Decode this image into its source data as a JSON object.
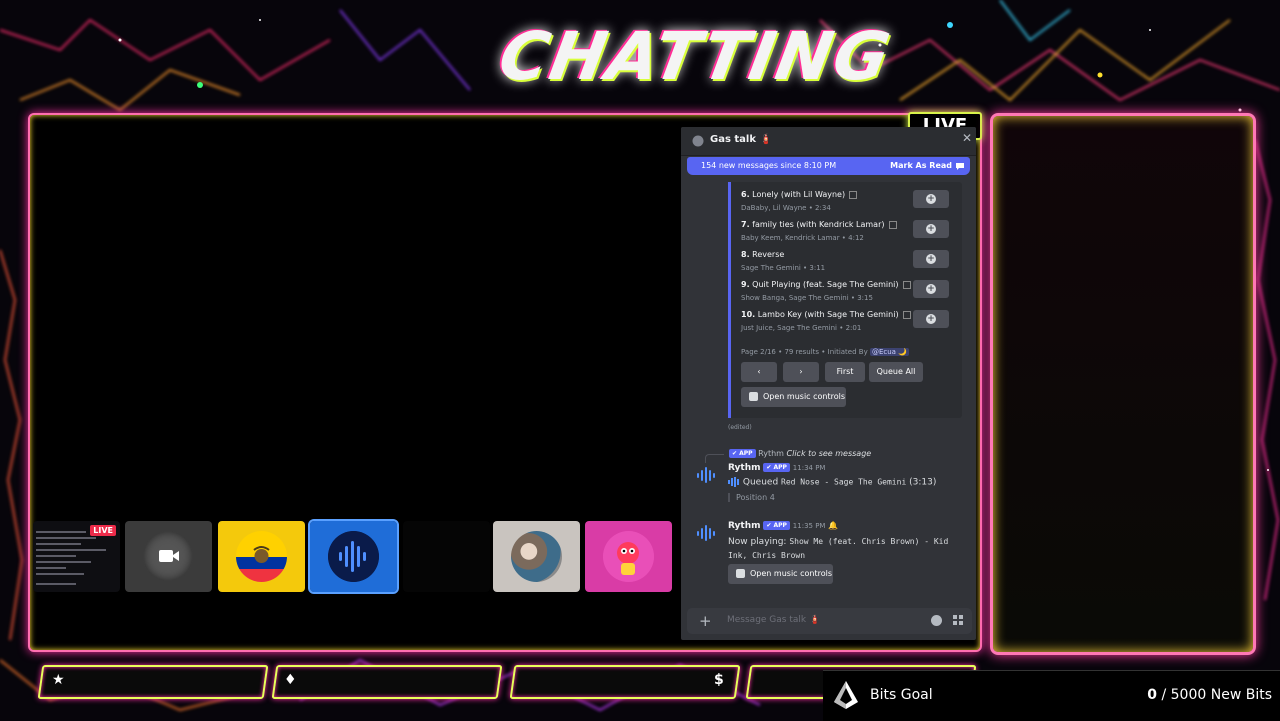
{
  "overlay": {
    "title": "CHATTING",
    "live_badge": "LIVE",
    "mini_live": "LIVE"
  },
  "discord": {
    "channel_name": "Gas talk 🧯",
    "new_messages_banner": "154 new messages since 8:10 PM",
    "mark_as_read": "Mark As Read",
    "tracks": [
      {
        "title_num": "6.",
        "title": "Lonely (with Lil Wayne)",
        "sub": "DaBaby, Lil Wayne • 2:34"
      },
      {
        "title_num": "7.",
        "title": "family ties (with Kendrick Lamar)",
        "sub": "Baby Keem, Kendrick Lamar • 4:12"
      },
      {
        "title_num": "8.",
        "title": "Reverse",
        "sub": "Sage The Gemini • 3:11"
      },
      {
        "title_num": "9.",
        "title": "Quit Playing (feat. Sage The Gemini)",
        "sub": "Show Banga, Sage The Gemini • 3:15"
      },
      {
        "title_num": "10.",
        "title": "Lambo Key (with Sage The Gemini)",
        "sub": "Just Juice, Sage The Gemini • 2:01"
      }
    ],
    "page_info": "Page 2/16 • 79 results • Initiated By",
    "initiator": "@Ecua 🌙",
    "buttons": {
      "prev": "‹",
      "next": "›",
      "first": "First",
      "queue_all": "Queue All",
      "open_music_controls": "Open music controls"
    },
    "edited": "(edited)",
    "reply": {
      "app_tag": "✔ APP",
      "user": "Rythm",
      "text": "Click to see message"
    },
    "messages": [
      {
        "user": "Rythm",
        "app_tag": "✔ APP",
        "time": "11:34 PM",
        "queued_label": "Queued",
        "queued_song": "Red Nose - Sage The Gemini",
        "queued_duration": "(3:13)",
        "position": "Position 4"
      },
      {
        "user": "Rythm",
        "app_tag": "✔ APP",
        "time": "11:35 PM",
        "now_playing_label": "Now playing:",
        "now_playing_song": "Show Me (feat. Chris Brown) - Kid Ink, Chris Brown",
        "open_music_controls": "Open music controls"
      }
    ],
    "composer_placeholder": "Message Gas talk 🧯"
  },
  "bits_goal": {
    "label": "Bits Goal",
    "current": "0",
    "target": "/ 5000 New Bits"
  },
  "slots": {
    "icons": [
      "★",
      "♦",
      "$"
    ]
  },
  "colors": {
    "discord_bg": "#313338",
    "blurple": "#5865f2",
    "frame_pink": "#ff6fb0",
    "frame_yellow": "#e8ff5a"
  }
}
